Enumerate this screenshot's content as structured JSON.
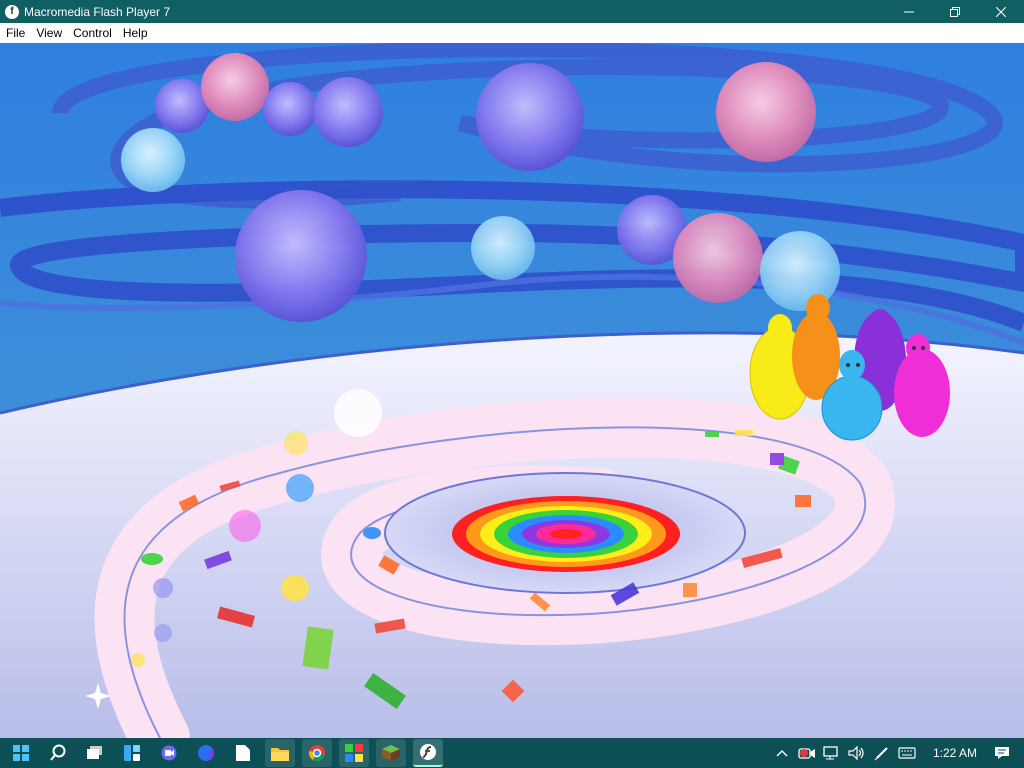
{
  "window": {
    "title": "Macromedia Flash Player 7",
    "icon": "flash-player-icon",
    "controls": [
      "minimize-icon",
      "maximize-icon",
      "close-icon"
    ]
  },
  "menu": [
    {
      "label": "File"
    },
    {
      "label": "View"
    },
    {
      "label": "Control"
    },
    {
      "label": "Help"
    }
  ],
  "stage": {
    "scene": "spiral-rainbow-path-with-bubbles-and-blob-characters",
    "colors": {
      "sky_top": "#2f7fe0",
      "sky_bottom": "#9ec93a",
      "ribbon": "#3d5fd0",
      "floor": "#dfe3f7",
      "path": "#f9dcf0",
      "characters": [
        "#f8ec18",
        "#f5901a",
        "#8b30d8",
        "#39b5ef",
        "#f02ed8"
      ]
    }
  },
  "taskbar": {
    "icons": [
      "start-icon",
      "search-icon",
      "task-view-icon",
      "widgets-icon",
      "chat-icon",
      "firefox-icon",
      "notepad-icon",
      "file-explorer-icon",
      "chrome-icon",
      "game-icon",
      "minecraft-icon",
      "flash-player-icon"
    ],
    "active": "flash-player-icon",
    "clock": "1:22 AM"
  }
}
